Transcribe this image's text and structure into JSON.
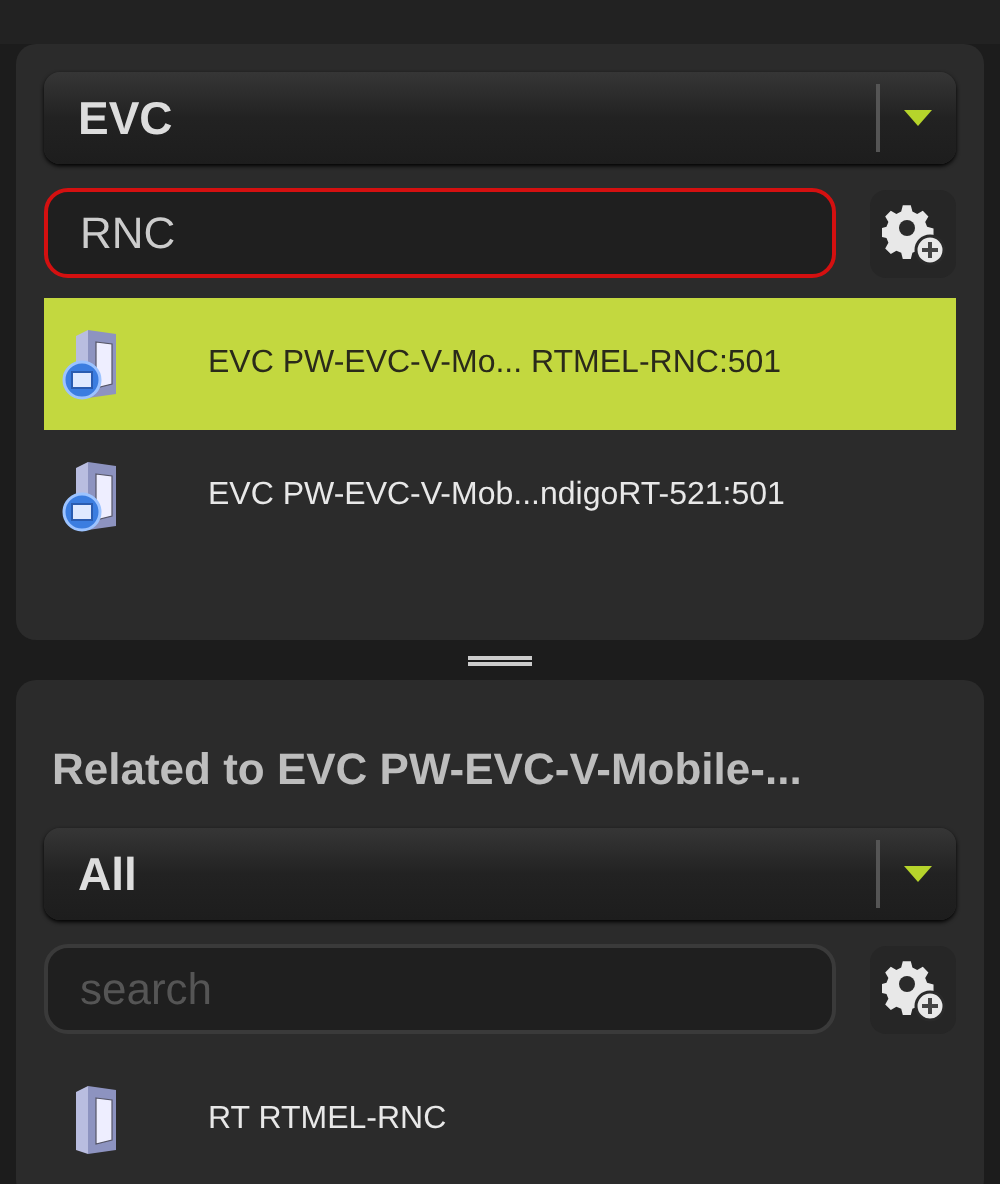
{
  "top_panel": {
    "type_dropdown": {
      "value": "EVC"
    },
    "search": {
      "value": "RNC",
      "invalid": true
    },
    "items": [
      {
        "kind": "evc",
        "label": "EVC PW-EVC-V-Mo... RTMEL-RNC:501",
        "selected": true
      },
      {
        "kind": "evc",
        "label": "EVC PW-EVC-V-Mob...ndigoRT-521:501",
        "selected": false
      }
    ]
  },
  "related_panel": {
    "title": "Related to EVC PW-EVC-V-Mobile-...",
    "filter_dropdown": {
      "value": "All"
    },
    "search": {
      "placeholder": "search",
      "invalid": false
    },
    "items": [
      {
        "kind": "rt",
        "label": "RT RTMEL-RNC",
        "selected": false
      }
    ]
  }
}
